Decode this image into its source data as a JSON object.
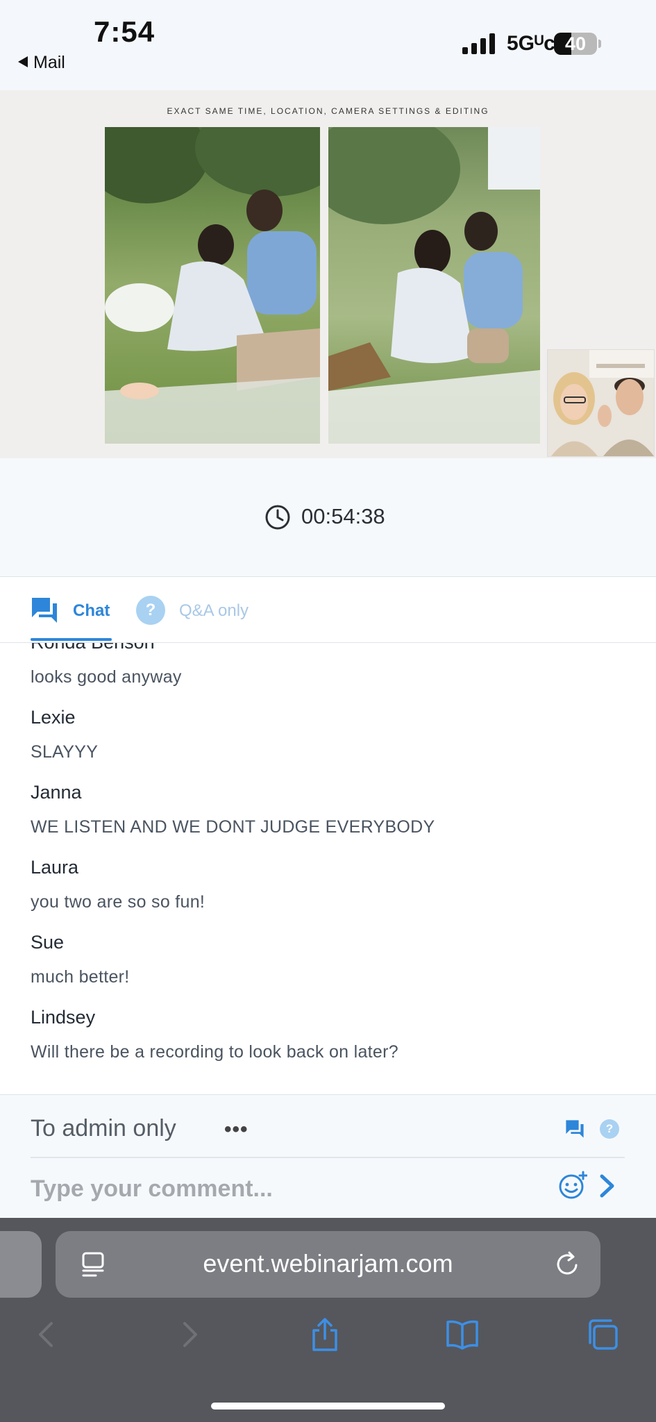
{
  "status_bar": {
    "time": "7:54",
    "back_label": "Mail",
    "network": "5Gᵁᴄ",
    "battery": "40"
  },
  "video": {
    "caption": "EXACT SAME TIME, LOCATION, CAMERA SETTINGS & EDITING"
  },
  "timer": {
    "elapsed": "00:54:38",
    "icon": "clock-icon"
  },
  "tabs": [
    {
      "label": "Chat",
      "icon": "chat-bubbles-icon",
      "active": true
    },
    {
      "label": "Q&A only",
      "icon": "question-circle-icon",
      "active": false
    }
  ],
  "chat": {
    "messages": [
      {
        "name": "Ronda Benson",
        "text": "looks good anyway"
      },
      {
        "name": "Lexie",
        "text": "SLAYYY"
      },
      {
        "name": "Janna",
        "text": "WE LISTEN AND WE DONT JUDGE EVERYBODY"
      },
      {
        "name": "Laura",
        "text": "you two are so so fun!"
      },
      {
        "name": "Sue",
        "text": "much better!"
      },
      {
        "name": "Lindsey",
        "text": "Will there be a recording to look back on later?"
      }
    ]
  },
  "composer": {
    "recipient": "To admin only",
    "more": "•••",
    "placeholder": "Type your comment..."
  },
  "browser": {
    "url": "event.webinarjam.com"
  },
  "colors": {
    "accent": "#2d86d9",
    "accent_light": "#a9d1f2",
    "safari_bar": "#55575c"
  }
}
